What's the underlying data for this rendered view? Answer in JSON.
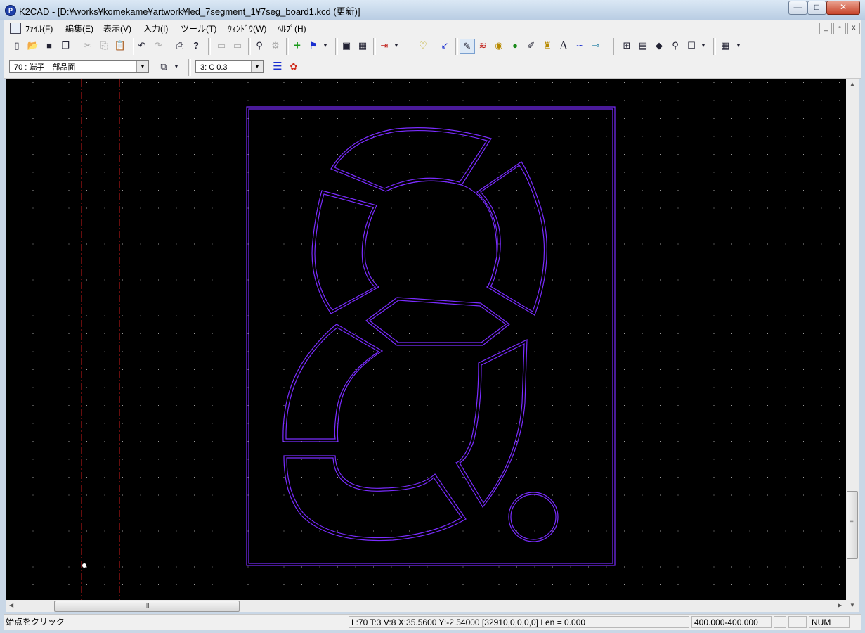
{
  "window": {
    "title": "K2CAD - [D:¥works¥komekame¥artwork¥led_7segment_1¥7seg_board1.kcd (更新)]",
    "app_icon_letter": "P",
    "minimize": "—",
    "maximize": "□",
    "close": "✕"
  },
  "menu": {
    "items": [
      "ﾌｧｲﾙ(F)",
      "編集(E)",
      "表示(V)",
      "入力(I)",
      "ツール(T)",
      "ｳｨﾝﾄﾞｳ(W)",
      "ﾍﾙﾌﾟ(H)"
    ],
    "mdi_minimize": "_",
    "mdi_restore": "▫",
    "mdi_close": "x"
  },
  "toolbar1": {
    "icons": [
      "new-file-icon",
      "open-folder-icon",
      "save-icon",
      "save-all-icon",
      "cut-icon",
      "copy-icon",
      "paste-icon",
      "undo-icon",
      "redo-icon",
      "print-icon",
      "help-icon",
      "layer-up-icon",
      "layer-down-icon",
      "binoculars-icon",
      "properties-icon",
      "add-icon",
      "flag-icon",
      "component-icon",
      "grid-toggle-icon",
      "import-icon",
      "marker-icon",
      "arrow-select-icon",
      "pencil-icon",
      "spiral-icon",
      "pad-icon",
      "ellipse-icon",
      "brush-icon",
      "trophy-icon",
      "text-icon",
      "curve-icon",
      "connector-icon",
      "zoom-in-icon",
      "zoom-window-icon",
      "flip-icon",
      "zoom-icon",
      "frame-icon",
      "grid-icon"
    ],
    "glyphs": [
      "▯",
      "📂",
      "■",
      "❐",
      "✂",
      "⎘",
      "📋",
      "↶",
      "↷",
      "⎙",
      "?",
      "▭",
      "▭",
      "⚲",
      "⚙",
      "+",
      "⚑",
      "▣",
      "▦",
      "⇥",
      "♡",
      "↙",
      "✎",
      "≋",
      "◉",
      "●",
      "✐",
      "♜",
      "A",
      "∽",
      "⊸",
      "⊞",
      "▤",
      "◆",
      "⚲",
      "☐",
      "▦"
    ]
  },
  "toolbar2": {
    "layer_select": "70 : 端子　部品面",
    "pen_select": "3: C 0.3",
    "icons": [
      "layer-options-icon",
      "line-style-icon",
      "color-palette-icon"
    ]
  },
  "canvas": {
    "background": "#000000",
    "grid_color": "#9a9a9a",
    "outline_color": "#7a2cff",
    "guide_line_color": "#cc1a1a",
    "origin_marker_color": "#ffffff"
  },
  "scrollbars": {
    "horizontal_thumb_grip": "III",
    "vertical_thumb_grip": "≡"
  },
  "status": {
    "message": "始点をクリック",
    "coordinates": "L:70 T:3 V:8 X:35.5600 Y:-2.54000 [32910,0,0,0,0] Len = 0.000",
    "scale": "400.000-400.000",
    "num": "NUM"
  }
}
